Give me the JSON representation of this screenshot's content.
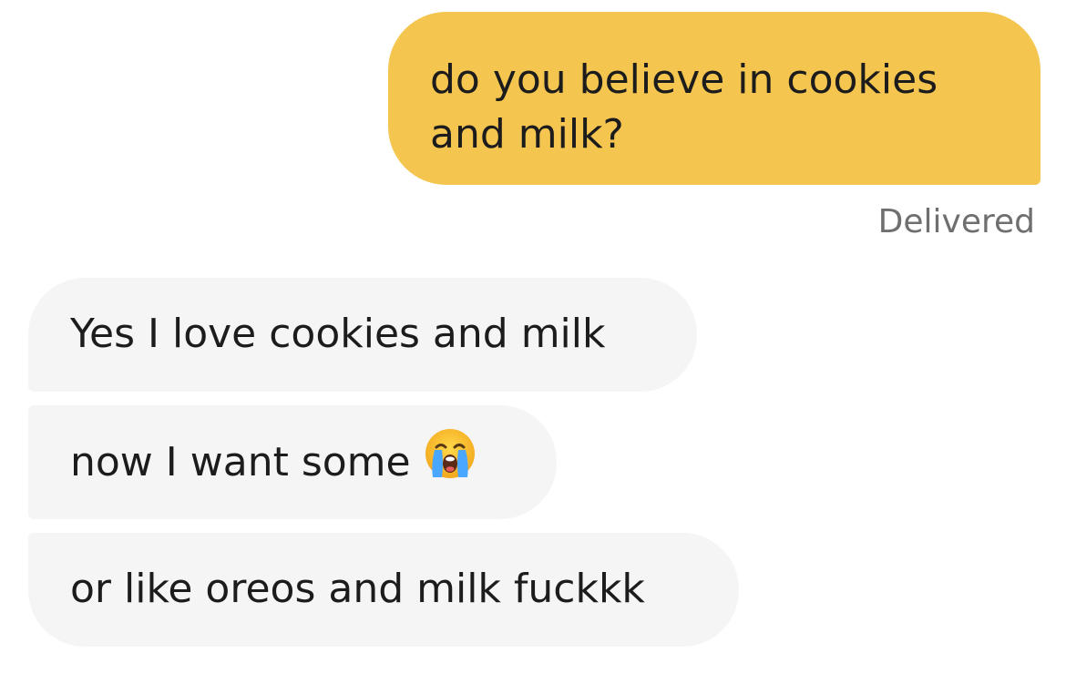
{
  "conversation": {
    "outgoing": [
      {
        "text": "do you believe in cookies and milk?"
      }
    ],
    "status": "Delivered",
    "incoming": [
      {
        "text": "Yes I love cookies and milk"
      },
      {
        "text": "now I want some",
        "icon": "loudly-crying-face-icon"
      },
      {
        "text": "or like oreos and milk fuckkk"
      }
    ]
  },
  "colors": {
    "outgoing_bubble": "#f4c54f",
    "incoming_bubble": "#f5f5f5",
    "status_text": "#6f6f6f",
    "message_text": "#1c1c1c"
  }
}
